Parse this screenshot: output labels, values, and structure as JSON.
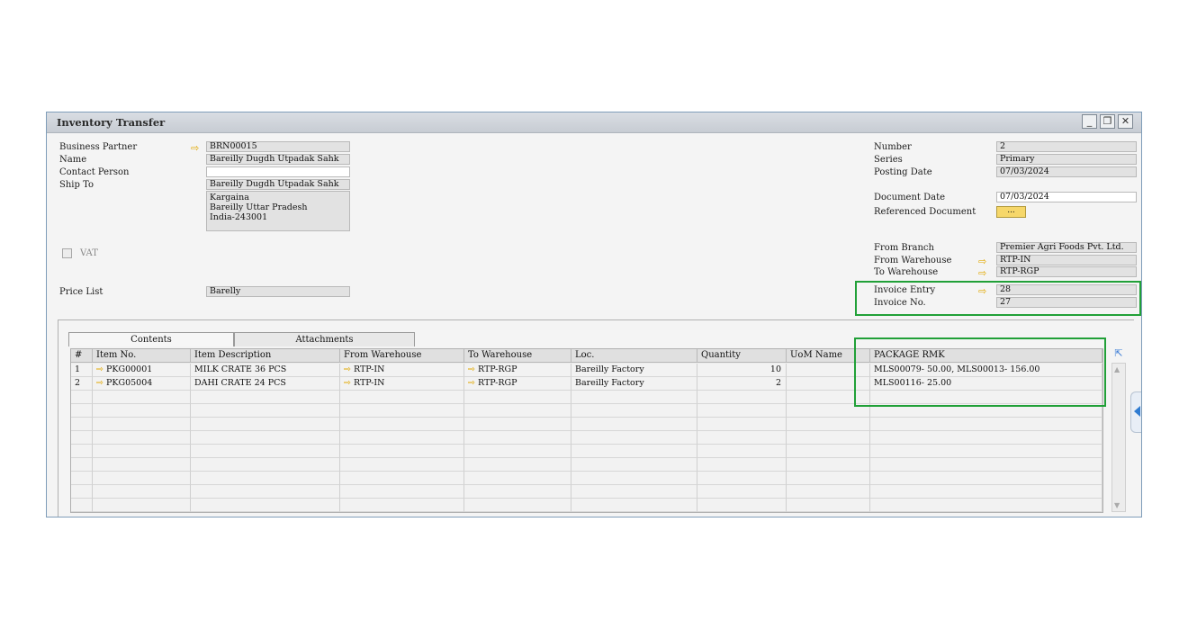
{
  "window": {
    "title": "Inventory Transfer"
  },
  "left": {
    "business_partner_label": "Business Partner",
    "business_partner": "BRN00015",
    "name_label": "Name",
    "name": "Bareilly Dugdh Utpadak Sahk",
    "contact_person_label": "Contact Person",
    "contact_person": "",
    "ship_to_label": "Ship To",
    "ship_to": "Bareilly Dugdh Utpadak Sahk",
    "address_line1": "Kargaina",
    "address_line2": "Bareilly Uttar Pradesh",
    "address_line3": "India-243001",
    "vat_label": "VAT",
    "price_list_label": "Price List",
    "price_list": "Barelly"
  },
  "right": {
    "number_label": "Number",
    "number": "2",
    "series_label": "Series",
    "series": "Primary",
    "posting_date_label": "Posting Date",
    "posting_date": "07/03/2024",
    "document_date_label": "Document Date",
    "document_date": "07/03/2024",
    "referenced_document_label": "Referenced Document",
    "referenced_document_button": "...",
    "from_branch_label": "From Branch",
    "from_branch": "Premier Agri Foods Pvt. Ltd.",
    "from_warehouse_label": "From Warehouse",
    "from_warehouse": "RTP-IN",
    "to_warehouse_label": "To Warehouse",
    "to_warehouse": "RTP-RGP",
    "invoice_entry_label": "Invoice Entry",
    "invoice_entry": "28",
    "invoice_no_label": "Invoice No.",
    "invoice_no": "27"
  },
  "tabs": [
    "Contents",
    "Attachments"
  ],
  "grid": {
    "columns": [
      "#",
      "Item No.",
      "Item Description",
      "From Warehouse",
      "To Warehouse",
      "Loc.",
      "Quantity",
      "UoM Name",
      "PACKAGE RMK"
    ],
    "rows": [
      {
        "n": "1",
        "item_no": "PKG00001",
        "desc": "MILK CRATE 36 PCS",
        "from_wh": "RTP-IN",
        "to_wh": "RTP-RGP",
        "loc": "Bareilly Factory",
        "qty": "10",
        "uom": "",
        "rmk": "MLS00079- 50.00, MLS00013- 156.00"
      },
      {
        "n": "2",
        "item_no": "PKG05004",
        "desc": "DAHI CRATE 24 PCS",
        "from_wh": "RTP-IN",
        "to_wh": "RTP-RGP",
        "loc": "Bareilly Factory",
        "qty": "2",
        "uom": "",
        "rmk": "MLS00116- 25.00"
      }
    ]
  },
  "colors": {
    "highlight": "#21a038",
    "link_arrow": "#e2a800"
  }
}
